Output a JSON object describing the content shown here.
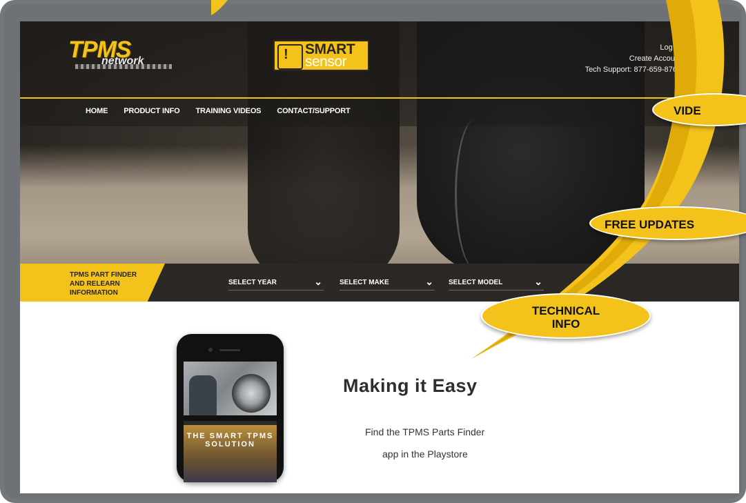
{
  "header": {
    "brand_primary": "TPMS",
    "brand_secondary": "network",
    "partner_logo_top": "SMART",
    "partner_logo_bottom": "sensor",
    "utility": {
      "login": "Log In",
      "create_account": "Create Account",
      "tech_support": "Tech Support: 877-659-8767"
    }
  },
  "nav": {
    "items": [
      "HOME",
      "PRODUCT INFO",
      "TRAINING VIDEOS",
      "CONTACT/SUPPORT"
    ]
  },
  "finder": {
    "label": "TPMS PART FINDER AND RELEARN INFORMATION",
    "selects": [
      {
        "value": "SELECT YEAR"
      },
      {
        "value": "SELECT MAKE"
      },
      {
        "value": "SELECT MODEL"
      }
    ]
  },
  "content": {
    "headline": "Making it Easy",
    "line1": "Find the TPMS Parts Finder",
    "line2": "app in the Playstore",
    "phone_video_title": "THE SMART TPMS SOLUTION"
  },
  "callouts": {
    "video": "VIDE",
    "free_updates": "FREE UPDATES",
    "technical_info_line1": "TECHNICAL",
    "technical_info_line2": "INFO"
  },
  "colors": {
    "brand_yellow": "#f3c21b",
    "header_dark": "#2b2825",
    "frame_gray": "#74777b"
  },
  "icons": {
    "select_chevron": "chevron-down-icon",
    "smart_logo_icon": "tire-pressure-warning-icon"
  }
}
